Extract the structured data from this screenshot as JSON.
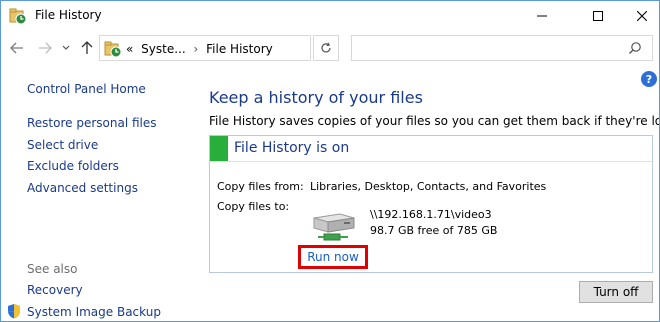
{
  "window": {
    "title": "File History"
  },
  "address": {
    "prefix": "«",
    "crumb_1": "Syste...",
    "separator": "›",
    "crumb_2": "File History"
  },
  "search": {
    "placeholder": "",
    "value": ""
  },
  "sidebar": {
    "home": "Control Panel Home",
    "links": [
      "Restore personal files",
      "Select drive",
      "Exclude folders",
      "Advanced settings"
    ],
    "see_also_heading": "See also",
    "see_also": [
      "Recovery",
      "System Image Backup"
    ]
  },
  "main": {
    "title": "Keep a history of your files",
    "description": "File History saves copies of your files so you can get them back if they're lost or damaged."
  },
  "panel": {
    "status": "File History is on",
    "status_color": "#27ae3b",
    "copy_from_label": "Copy files from:",
    "copy_from_value": "Libraries, Desktop, Contacts, and Favorites",
    "copy_to_label": "Copy files to:",
    "drive_path": "\\\\192.168.1.71\\video3",
    "drive_space": "98.7 GB free of 785 GB",
    "run_now": "Run now"
  },
  "buttons": {
    "turn_off": "Turn off"
  },
  "icons": {
    "app": "file-history-icon",
    "drive": "network-drive-icon",
    "help": "help-icon",
    "shield": "uac-shield-icon"
  },
  "help_label": "?"
}
